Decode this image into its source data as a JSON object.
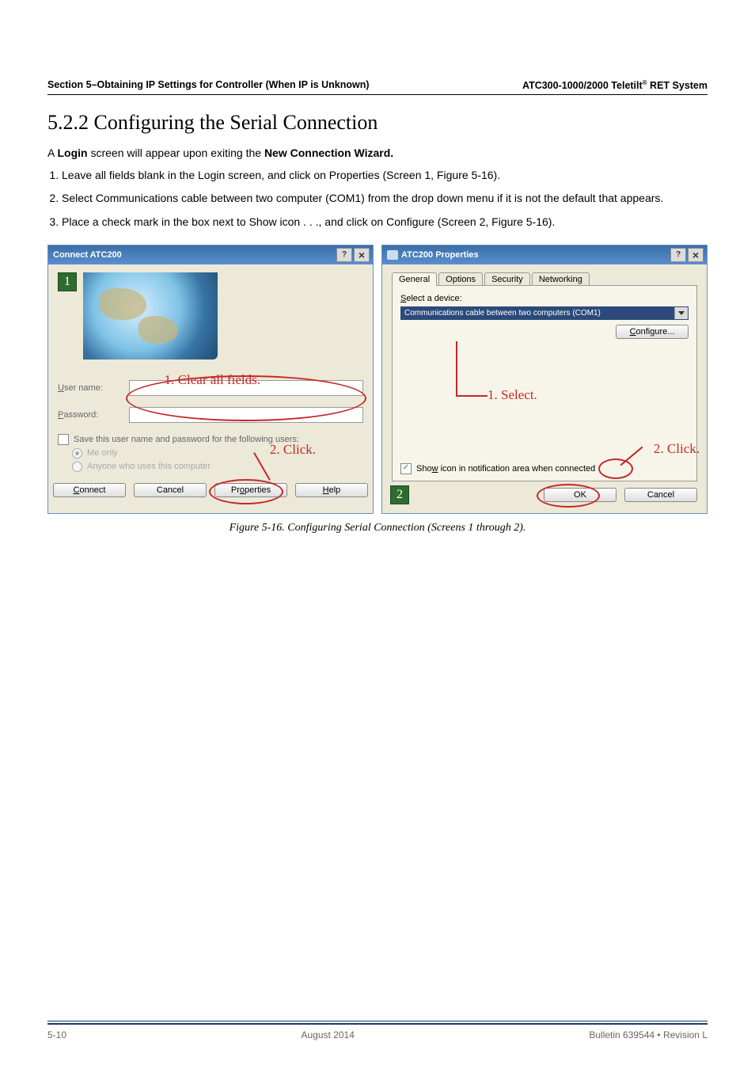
{
  "header": {
    "left": "Section 5–Obtaining IP Settings for Controller (When IP is Unknown)",
    "right_prefix": "ATC300-1000/2000 Teletilt",
    "right_sup": "®",
    "right_suffix": " RET System"
  },
  "section_title": "5.2.2 Configuring the Serial Connection",
  "intro_a": "A ",
  "intro_b": "Login",
  "intro_c": " screen will appear upon exiting the ",
  "intro_d": "New Connection Wizard.",
  "steps": [
    {
      "pre": "Leave all fields blank in the ",
      "b1": "Login",
      "mid": " screen, and click on ",
      "b2": "Properties",
      "post": " (Screen 1, Figure 5-16)."
    },
    {
      "pre": "Select ",
      "b1": "Communications cable between two computer (COM1)",
      "mid": " from the drop down menu if it is not the default that appears.",
      "b2": "",
      "post": ""
    },
    {
      "pre": "Place a check mark in the box next to ",
      "b1": "Show icon",
      "mid": " . . ., and click on ",
      "b2": "Configure",
      "post": " (Screen 2, Figure 5-16)."
    }
  ],
  "dialog1": {
    "title": "Connect ATC200",
    "badge": "1",
    "username_label": "User name:",
    "password_label": "Password:",
    "save_label": "Save this user name and password for the following users:",
    "radio1": "Me only",
    "radio2": "Anyone who uses this computer",
    "btn_connect": "Connect",
    "btn_cancel": "Cancel",
    "btn_properties": "Properties",
    "btn_help": "Help",
    "ann_fields": "1. Clear all fields.",
    "ann_click": "2. Click."
  },
  "dialog2": {
    "title": "ATC200 Properties",
    "tabs": [
      "General",
      "Options",
      "Security",
      "Networking"
    ],
    "select_label_pre": "S",
    "select_label_rest": "elect a device:",
    "combo_text": "Communications cable between two computers (COM1)",
    "btn_configure_pre": "C",
    "btn_configure_rest": "onfigure...",
    "show_icon_pre": "Sho",
    "show_icon_u": "w",
    "show_icon_rest": " icon in notification area when connected",
    "btn_ok": "OK",
    "btn_cancel": "Cancel",
    "badge": "2",
    "ann_select": "1. Select.",
    "ann_click": "2. Click."
  },
  "figure_caption": "Figure 5-16. Configuring Serial Connection (Screens 1 through 2).",
  "footer": {
    "left": "5-10",
    "center": "August 2014",
    "right": "Bulletin 639544  •  Revision L"
  }
}
